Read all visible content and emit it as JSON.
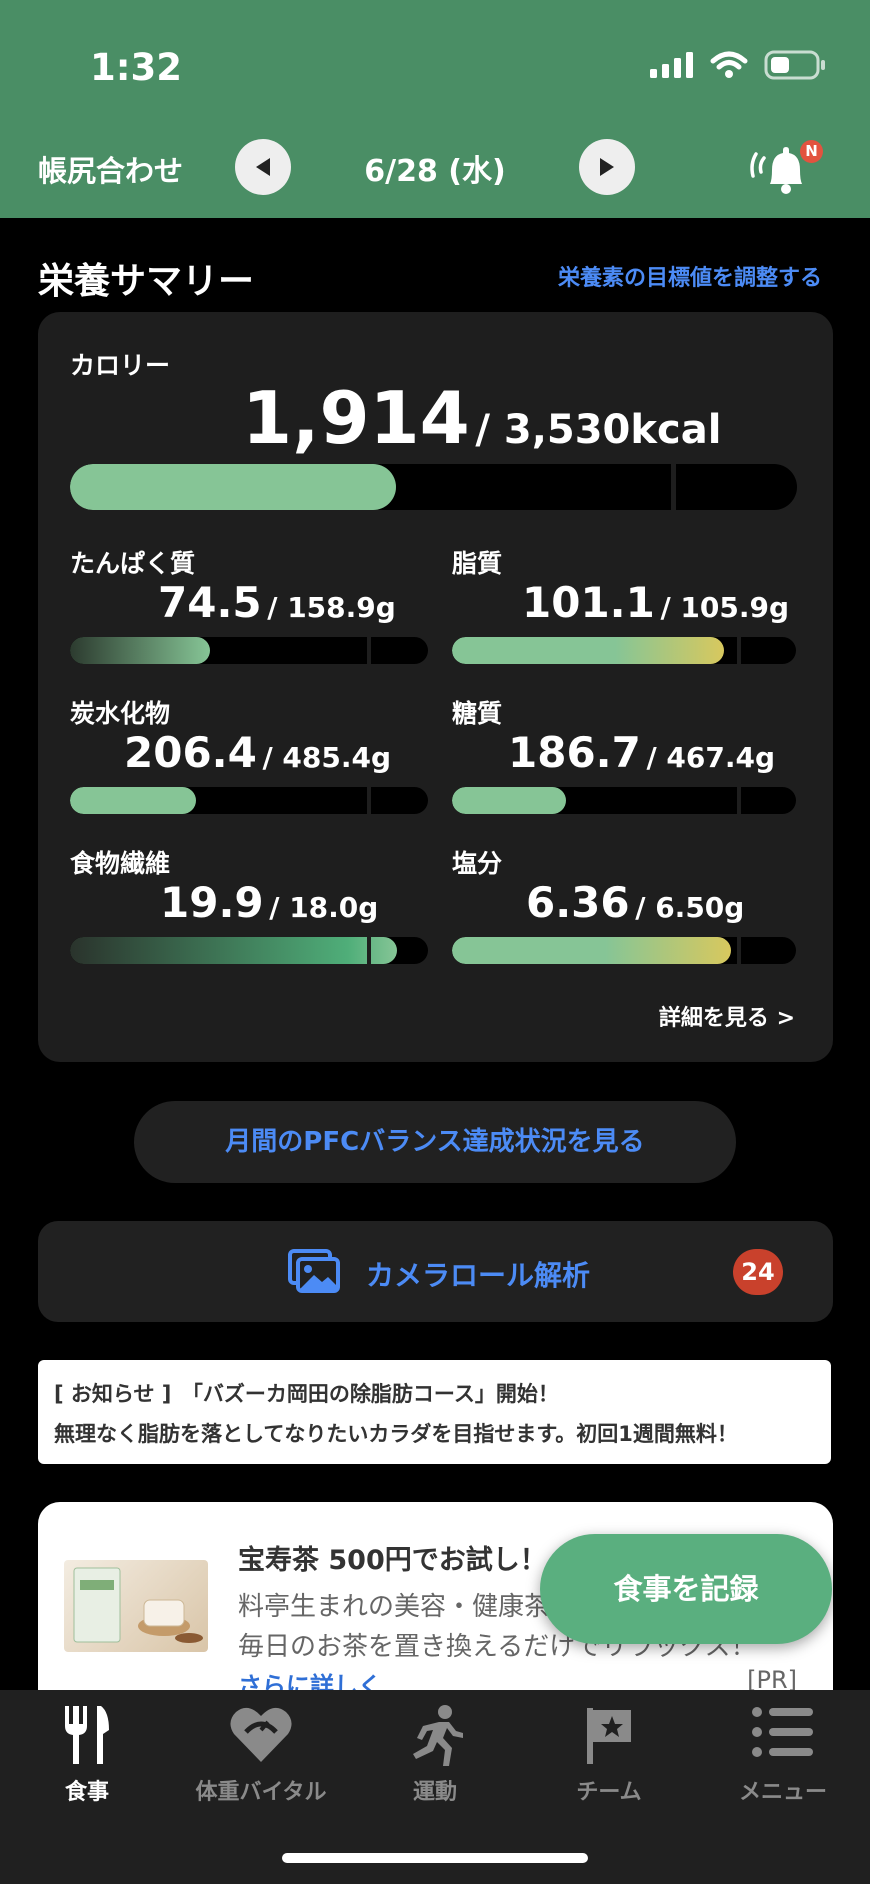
{
  "status_bar": {
    "time": "1:32"
  },
  "header": {
    "title": "帳尻合わせ",
    "date": "6/28 (水)",
    "notification_badge": "N"
  },
  "summary": {
    "title": "栄養サマリー",
    "adjust_link": "栄養素の目標値を調整する",
    "calorie": {
      "label": "カロリー",
      "value": "1,914",
      "target": "/ 3,530kcal",
      "fill_fraction": 0.542
    },
    "nutrients": [
      {
        "label": "たんぱく質",
        "value": "74.5",
        "target": "/ 158.9g",
        "fill_fraction": 0.47
      },
      {
        "label": "脂質",
        "value": "101.1",
        "target": "/ 105.9g",
        "fill_fraction": 0.955
      },
      {
        "label": "炭水化物",
        "value": "206.4",
        "target": "/ 485.4g",
        "fill_fraction": 0.425
      },
      {
        "label": "糖質",
        "value": "186.7",
        "target": "/ 467.4g",
        "fill_fraction": 0.4
      },
      {
        "label": "食物繊維",
        "value": "19.9",
        "target": "/ 18.0g",
        "fill_fraction": 1.1
      },
      {
        "label": "塩分",
        "value": "6.36",
        "target": "/ 6.50g",
        "fill_fraction": 0.978
      }
    ],
    "details_link": "詳細を見る >"
  },
  "pfc_button": "月間のPFCバランス達成状況を見る",
  "camera_roll": {
    "label": "カメラロール解析",
    "count": "24"
  },
  "notice": {
    "line1": "[ お知らせ ]　「バズーカ岡田の除脂肪コース」開始！",
    "line2": "無理なく脂肪を落としてなりたいカラダを目指せます。初回1週間無料！"
  },
  "ad": {
    "title": "宝寿茶 500円でお試し！",
    "line1": "料亭生まれの美容・健康茶",
    "line2": "毎日のお茶を置き換えるだけでリラックス！",
    "link": "さらに詳しく",
    "pr": "[PR]"
  },
  "fab_label": "食事を記録",
  "tabs": [
    {
      "label": "食事",
      "icon": "fork-knife-icon"
    },
    {
      "label": "体重バイタル",
      "icon": "heart-scale-icon"
    },
    {
      "label": "運動",
      "icon": "runner-icon"
    },
    {
      "label": "チーム",
      "icon": "flag-icon"
    },
    {
      "label": "メニュー",
      "icon": "menu-list-icon"
    }
  ],
  "colors": {
    "header": "#4a8e65",
    "accent_blue": "#4c8bf5",
    "bar_green": "#86c596",
    "fab": "#5aaf7f",
    "badge_red": "#c9412c"
  }
}
